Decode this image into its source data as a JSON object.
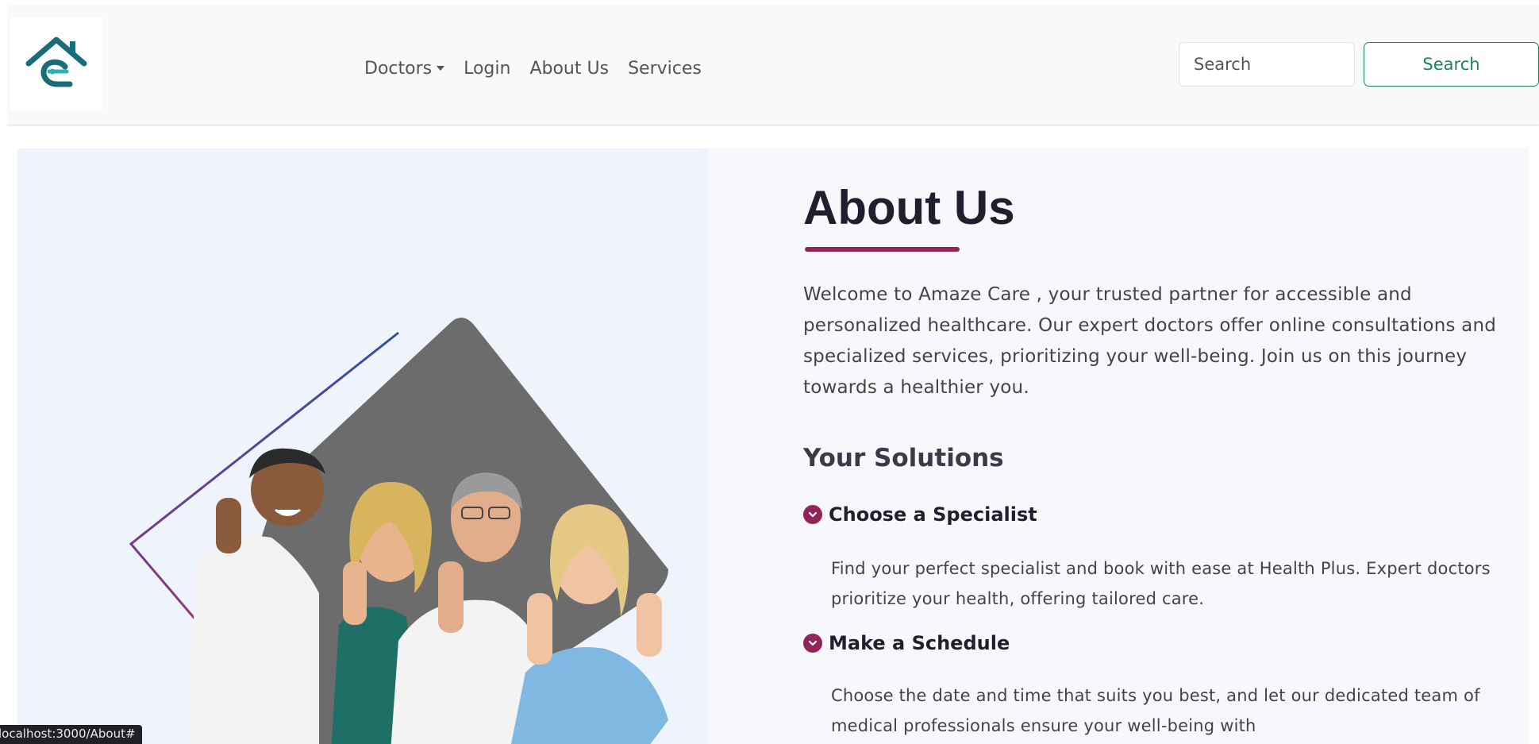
{
  "nav": {
    "logo_alt": "Amaze Care logo",
    "links": [
      {
        "label": "Doctors",
        "has_dropdown": true
      },
      {
        "label": "Login"
      },
      {
        "label": "About Us"
      },
      {
        "label": "Services"
      }
    ],
    "search_placeholder": "Search",
    "search_button_label": "Search",
    "brand_colors": {
      "teal": "#1a7f86",
      "accent": "#198754"
    }
  },
  "about": {
    "title": "About Us",
    "intro": "Welcome to Amaze Care , your trusted partner for accessible and personalized healthcare. Our expert doctors offer online consultations and specialized services, prioritizing your well-being. Join us on this journey towards a healthier you.",
    "solutions_title": "Your Solutions",
    "solutions": [
      {
        "heading": "Choose a Specialist",
        "icon": "chevron-circle-icon",
        "description": "Find your perfect specialist and book with ease at Health Plus. Expert doctors prioritize your health, offering tailored care."
      },
      {
        "heading": "Make a Schedule",
        "icon": "chevron-circle-icon",
        "description": "Choose the date and time that suits you best, and let our dedicated team of medical professionals ensure your well-being with"
      }
    ],
    "accent_color": "#93245a"
  },
  "status_bar": {
    "url": "localhost:3000/About#"
  }
}
